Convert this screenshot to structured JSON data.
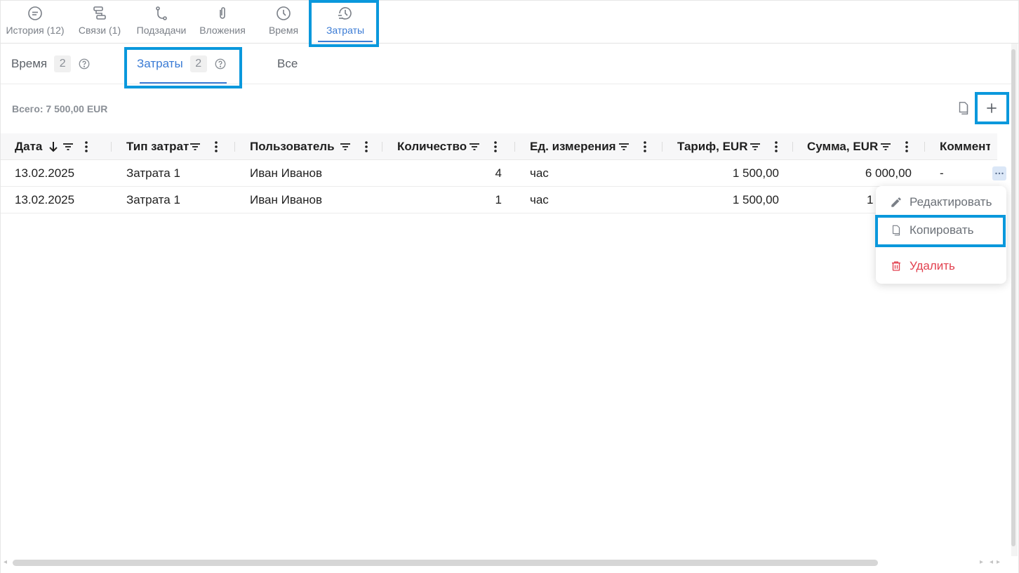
{
  "top_tabs": [
    {
      "label": "История (12)",
      "icon": "history-chat-icon",
      "active": false
    },
    {
      "label": "Связи (1)",
      "icon": "links-icon",
      "active": false
    },
    {
      "label": "Подзадачи",
      "icon": "subtasks-icon",
      "active": false
    },
    {
      "label": "Вложения",
      "icon": "paperclip-icon",
      "active": false
    },
    {
      "label": "Время",
      "icon": "clock-icon",
      "active": false
    },
    {
      "label": "Затраты",
      "icon": "costs-clock-icon",
      "active": true
    }
  ],
  "sub_tabs": [
    {
      "label": "Время",
      "count": "2",
      "active": false
    },
    {
      "label": "Затраты",
      "count": "2",
      "active": true
    },
    {
      "label": "Все",
      "active": false
    }
  ],
  "toolbar": {
    "total": "Всего: 7 500,00 EUR",
    "copy_icon": "copy-icon",
    "add_icon": "plus-icon"
  },
  "table": {
    "columns": [
      "Дата",
      "Тип затрат",
      "Пользователь",
      "Количество",
      "Ед. измерения",
      "Тариф, EUR",
      "Сумма, EUR",
      "Коммент"
    ],
    "rows": [
      {
        "date": "13.02.2025",
        "type": "Затрата 1",
        "user": "Иван Иванов",
        "qty": "4",
        "unit": "час",
        "rate": "1 500,00",
        "sum": "6 000,00",
        "comment": "-"
      },
      {
        "date": "13.02.2025",
        "type": "Затрата 1",
        "user": "Иван Иванов",
        "qty": "1",
        "unit": "час",
        "rate": "1 500,00",
        "sum": "1"
      }
    ]
  },
  "context_menu": {
    "items": [
      {
        "label": "Редактировать",
        "icon": "pencil-icon"
      },
      {
        "label": "Копировать",
        "icon": "copy-icon"
      },
      {
        "label": "Удалить",
        "icon": "trash-icon"
      }
    ]
  },
  "colors": {
    "accent": "#3a7bd5",
    "highlight": "#0a98dc",
    "danger": "#e2414f",
    "muted": "#7a7f87"
  }
}
